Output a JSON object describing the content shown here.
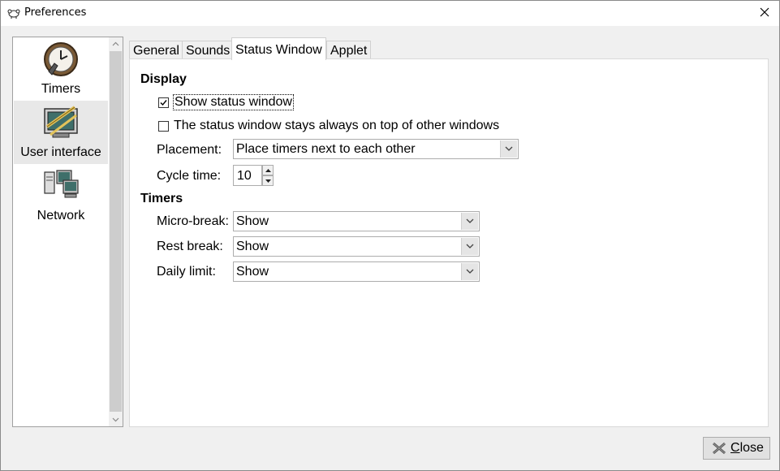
{
  "window": {
    "title": "Preferences"
  },
  "sidebar": {
    "items": [
      {
        "label": "Timers",
        "icon": "timers-clock-icon"
      },
      {
        "label": "User interface",
        "icon": "user-interface-icon"
      },
      {
        "label": "Network",
        "icon": "network-computers-icon"
      }
    ],
    "selected": "User interface"
  },
  "tabs": [
    "General",
    "Sounds",
    "Status Window",
    "Applet"
  ],
  "active_tab": "Status Window",
  "display": {
    "heading": "Display",
    "show_status_window": {
      "label": "Show status window",
      "checked": true
    },
    "always_on_top": {
      "label": "The status window stays always on top of other windows",
      "checked": false
    },
    "placement": {
      "label": "Placement:",
      "value": "Place timers next to each other"
    },
    "cycle_time": {
      "label": "Cycle time:",
      "value": "10"
    }
  },
  "timers": {
    "heading": "Timers",
    "micro_break": {
      "label": "Micro-break:",
      "value": "Show"
    },
    "rest_break": {
      "label": "Rest break:",
      "value": "Show"
    },
    "daily_limit": {
      "label": "Daily limit:",
      "value": "Show"
    }
  },
  "buttons": {
    "close": "lose",
    "close_mnemonic": "C"
  }
}
